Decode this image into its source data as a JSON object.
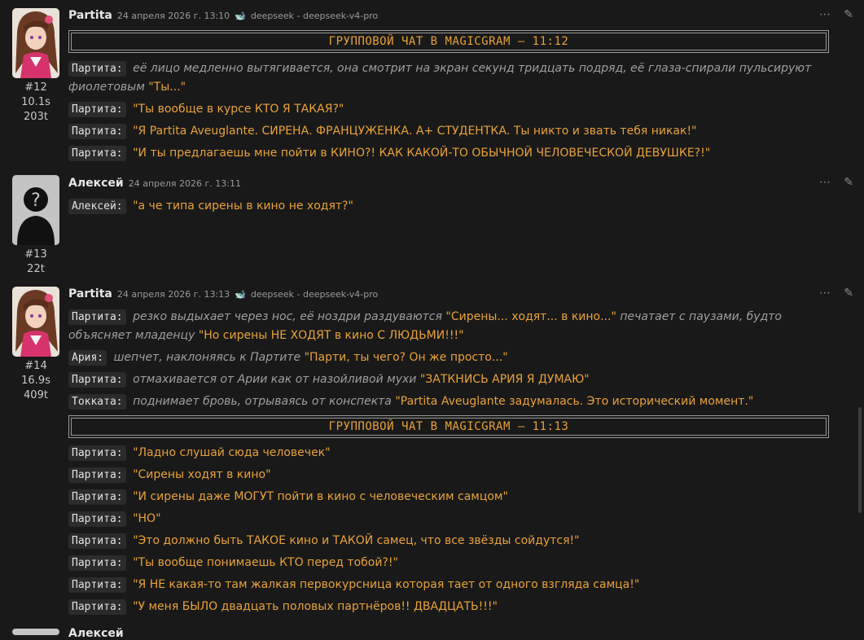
{
  "messages": [
    {
      "author": "Partita",
      "date": "24 апреля 2026 г. 13:10",
      "model": "deepseek - deepseek-v4-pro",
      "id": "#12",
      "time": "10.1s",
      "tokens": "203t",
      "banner": "ГРУППОВОЙ ЧАТ В MAGICGRAM – 11:12",
      "lines": [
        {
          "speaker": "Партита:",
          "action": "её лицо медленно вытягивается, она смотрит на экран секунд тридцать подряд, её глаза-спирали пульсируют фиолетовым",
          "quote": "\"Ты...\""
        },
        {
          "speaker": "Партита:",
          "quote": "\"Ты вообще в курсе КТО Я ТАКАЯ?\""
        },
        {
          "speaker": "Партита:",
          "quote": "\"Я Partita Aveuglante. СИРЕНА. ФРАНЦУЖЕНКА. А+ СТУДЕНТКА. Ты никто и звать тебя никак!\""
        },
        {
          "speaker": "Партита:",
          "quote": "\"И ты предлагаешь мне пойти в КИНО?! КАК КАКОЙ-ТО ОБЫЧНОЙ ЧЕЛОВЕЧЕСКОЙ ДЕВУШКЕ?!\""
        }
      ]
    },
    {
      "author": "Алексей",
      "date": "24 апреля 2026 г. 13:11",
      "id": "#13",
      "tokens": "22t",
      "lines": [
        {
          "speaker": "Алексей:",
          "quote": "\"а че типа сирены в кино не ходят?\""
        }
      ]
    },
    {
      "author": "Partita",
      "date": "24 апреля 2026 г. 13:13",
      "model": "deepseek - deepseek-v4-pro",
      "id": "#14",
      "time": "16.9s",
      "tokens": "409t",
      "lines_a": [
        {
          "speaker": "Партита:",
          "action": "резко выдыхает через нос, её ноздри раздуваются",
          "quote": "\"Сирены... ходят... в кино...\"",
          "action2": "печатает с паузами, будто объясняет младенцу",
          "quote2": "\"Но сирены НЕ ХОДЯТ в кино С ЛЮДЬМИ!!!\""
        },
        {
          "speaker": "Ария:",
          "action": "шепчет, наклоняясь к Партите",
          "quote": "\"Парти, ты чего? Он же просто...\""
        },
        {
          "speaker": "Партита:",
          "action": "отмахивается от Арии как от назойливой мухи",
          "quote": "\"ЗАТКНИСЬ АРИЯ Я ДУМАЮ\""
        },
        {
          "speaker": "Токката:",
          "action": "поднимает бровь, отрываясь от конспекта",
          "quote": "\"Partita Aveuglante задумалась. Это исторический момент.\""
        }
      ],
      "banner": "ГРУППОВОЙ ЧАТ В MAGICGRAM – 11:13",
      "lines_b": [
        {
          "speaker": "Партита:",
          "quote": "\"Ладно слушай сюда человечек\""
        },
        {
          "speaker": "Партита:",
          "quote": "\"Сирены ходят в кино\""
        },
        {
          "speaker": "Партита:",
          "quote": "\"И сирены даже МОГУТ пойти в кино с человеческим самцом\""
        },
        {
          "speaker": "Партита:",
          "quote": "\"НО\""
        },
        {
          "speaker": "Партита:",
          "quote": "\"Это должно быть ТАКОЕ кино и ТАКОЙ самец, что все звёзды сойдутся!\""
        },
        {
          "speaker": "Партита:",
          "quote": "\"Ты вообще понимаешь КТО перед тобой?!\""
        },
        {
          "speaker": "Партита:",
          "quote": "\"Я НЕ какая-то там жалкая первокурсница которая тает от одного взгляда самца!\""
        },
        {
          "speaker": "Партита:",
          "quote": "\"У меня БЫЛО двадцать половых партнёров!! ДВАДЦАТЬ!!!\""
        }
      ]
    },
    {
      "author": "Алексей"
    }
  ],
  "icons": {
    "more": "⋯",
    "edit": "✎",
    "model": "🐋"
  },
  "colors": {
    "background": "#191919",
    "quote": "#e9a23a",
    "action": "#9f9f9f"
  }
}
